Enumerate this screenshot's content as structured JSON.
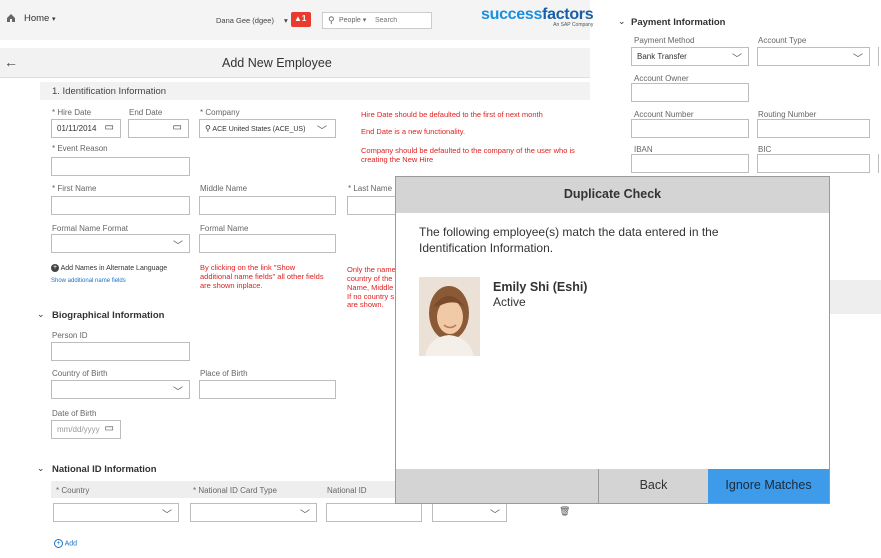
{
  "topbar": {
    "home": "Home",
    "user": "Dana Gee (dgee)",
    "notifications": "1",
    "people": "People",
    "search_placeholder": "Search",
    "logo_main": "success",
    "logo_accent": "factors",
    "logo_sub": "An SAP Company"
  },
  "page": {
    "title": "Add New Employee"
  },
  "ident": {
    "title": "1. Identification Information",
    "hire_date_label": "* Hire Date",
    "hire_date_value": "01/11/2014",
    "end_date_label": "End Date",
    "company_label": "* Company",
    "company_value": "ACE United States (ACE_US)",
    "event_reason_label": "* Event Reason",
    "first_name_label": "* First Name",
    "middle_name_label": "Middle Name",
    "last_name_label": "* Last Name",
    "formal_format_label": "Formal Name Format",
    "formal_name_label": "Formal Name",
    "note_hire": "Hire Date should be defaulted to the first of next month",
    "note_end": "End Date is a new functionality.",
    "note_company1": "Company should be defaulted to the company of the user who is",
    "note_company2": "creating the New Hire",
    "alt_lang": "Add Names in Alternate Language",
    "show_additional": "Show additional name fields",
    "note_link1": "By clicking on the link \"Show",
    "note_link2": "additional name fields\" all other fields",
    "note_link3": "are shown inplace.",
    "note_only1": "Only the name",
    "note_only2": "country of the",
    "note_only3": "Name, Middle",
    "note_only4": "If no country s",
    "note_only5": "are shown."
  },
  "bio": {
    "title": "Biographical Information",
    "person_id_label": "Person ID",
    "country_birth_label": "Country of Birth",
    "place_birth_label": "Place of Birth",
    "dob_label": "Date of Birth",
    "dob_placeholder": "mm/dd/yyyy"
  },
  "nid": {
    "title": "National ID Information",
    "col_country": "* Country",
    "col_type": "* National ID Card Type",
    "col_nid": "National ID",
    "add": "Add"
  },
  "payment": {
    "title": "Payment Information",
    "method_label": "Payment Method",
    "method_value": "Bank Transfer",
    "account_type_label": "Account Type",
    "owner_label": "Account Owner",
    "number_label": "Account Number",
    "routing_label": "Routing Number",
    "iban_label": "IBAN",
    "bic_label": "BIC"
  },
  "dialog": {
    "title": "Duplicate Check",
    "message": "The following employee(s) match the data entered in the Identification Information.",
    "name": "Emily Shi (Eshi)",
    "status": "Active",
    "back": "Back",
    "ignore": "Ignore Matches"
  },
  "colors": {
    "accent": "#3d9be9",
    "required": "#1a73c8",
    "notice_red": "#e02020",
    "logo_blue": "#1a8ee0",
    "logo_orange": "#f08a24",
    "badge_red": "#e63b2e"
  }
}
